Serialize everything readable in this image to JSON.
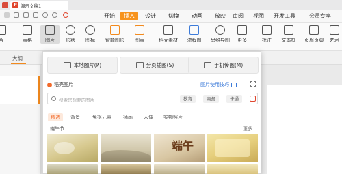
{
  "titlebar": {
    "doc_name": "演示文稿1",
    "app_icon": "P"
  },
  "menu": {
    "items": [
      "开始",
      "插入",
      "设计",
      "切换",
      "动画",
      "放映",
      "审阅",
      "视图",
      "开发工具",
      "会员专享"
    ],
    "active": "插入"
  },
  "ribbon": {
    "items": [
      "片",
      "表格",
      "图片",
      "形状",
      "图标",
      "智能图形",
      "图表",
      "稻壳素材",
      "流程图",
      "思维导图",
      "更多",
      "批注",
      "文本框",
      "页眉页脚",
      "艺术"
    ]
  },
  "doc_row": {
    "outline_label": "大纲"
  },
  "panel": {
    "buttons": {
      "local": "本地图片(P)",
      "paged": "分页插图(S)",
      "phone": "手机传图(M)"
    },
    "docer_header": "稻壳图片",
    "tips_link": "图片使用技巧",
    "search": {
      "placeholder": "搜索您想要的图片",
      "chips": [
        "教育",
        "商务",
        "卡通"
      ]
    },
    "categories": [
      "精选",
      "背景",
      "免抠元素",
      "插画",
      "人像",
      "实物照片"
    ],
    "active_category": "精选",
    "group_title": "端午节",
    "more_label": "更多",
    "thumb_text": "端午"
  }
}
